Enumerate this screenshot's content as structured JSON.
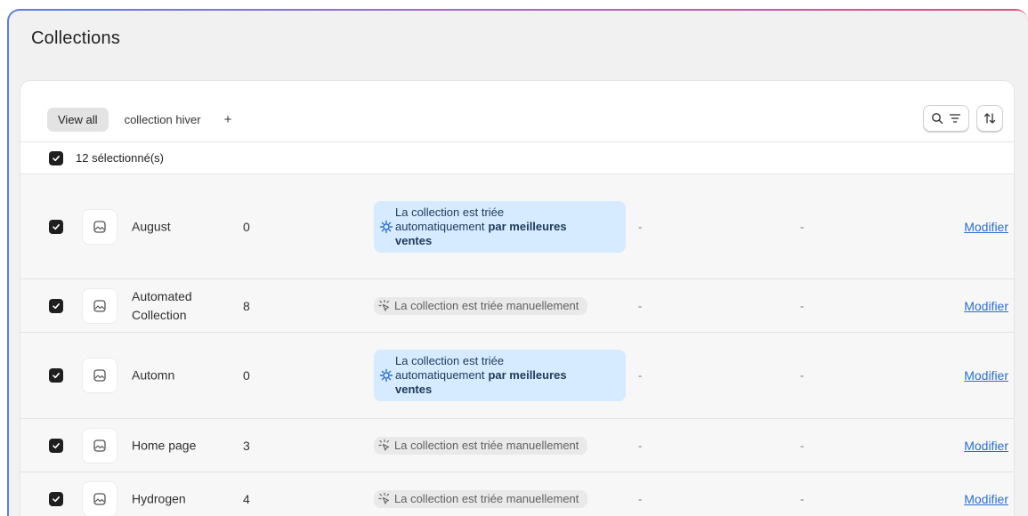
{
  "page": {
    "title": "Collections"
  },
  "tabs": [
    {
      "label": "View all"
    },
    {
      "label": "collection hiver"
    },
    {
      "label": "+"
    }
  ],
  "selection": {
    "text": "12 sélectionné(s)"
  },
  "labels": {
    "auto_line1": "La collection est triée",
    "auto_line2": "automatiquement",
    "auto_bold": "par meilleures",
    "auto_line3": "ventes",
    "manual": "La collection est triée manuellement",
    "dash": "-",
    "modify": "Modifier"
  },
  "rows": [
    {
      "name": "August",
      "count": "0",
      "sort": "auto"
    },
    {
      "name": "Automated Collection",
      "count": "8",
      "sort": "manual"
    },
    {
      "name": "Automn",
      "count": "0",
      "sort": "auto"
    },
    {
      "name": "Home page",
      "count": "3",
      "sort": "manual"
    },
    {
      "name": "Hydrogen",
      "count": "4",
      "sort": "manual"
    }
  ],
  "colors": {
    "accent_link": "#2c6ecb",
    "auto_badge_bg": "#d6ebff",
    "manual_badge_bg": "#e9e9e9"
  },
  "icons": [
    "search-icon",
    "filter-icon",
    "sort-icon",
    "checkmark-icon",
    "image-placeholder-icon",
    "gear-sort-icon",
    "manual-sort-icon"
  ]
}
